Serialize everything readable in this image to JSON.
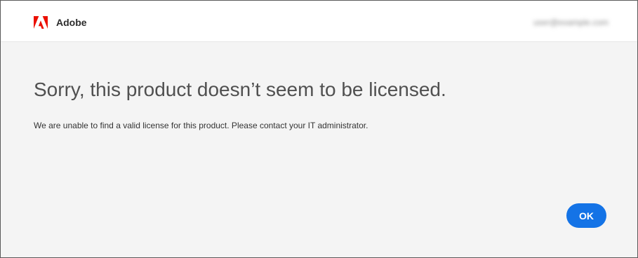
{
  "header": {
    "brand_name": "Adobe",
    "logo_icon": "adobe-logo-icon",
    "logo_color": "#eb1000",
    "account_label": "user@example.com"
  },
  "dialog": {
    "title": "Sorry, this product doesn’t seem to be licensed.",
    "message": "We are unable to find a valid license for this product. Please contact your IT administrator.",
    "ok_label": "OK"
  },
  "colors": {
    "accent": "#1473e6",
    "background": "#f4f4f4",
    "header_background": "#ffffff"
  }
}
